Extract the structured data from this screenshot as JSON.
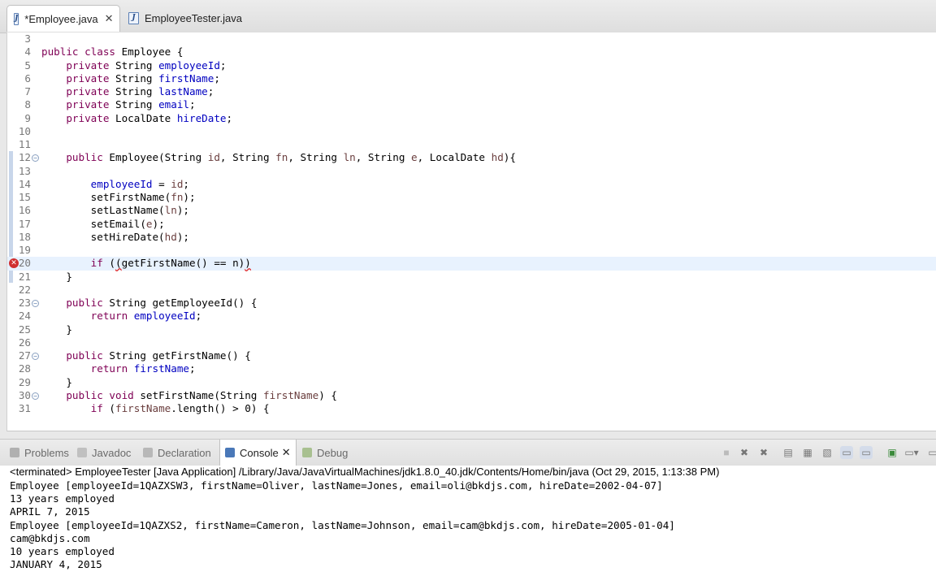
{
  "editor_tabs": [
    {
      "label": "*Employee.java",
      "close": "✕"
    },
    {
      "label": "EmployeeTester.java"
    }
  ],
  "code_lines": [
    {
      "num": "3",
      "html": ""
    },
    {
      "num": "4",
      "html": "<span class='kw'>public class</span> Employee {"
    },
    {
      "num": "5",
      "html": "    <span class='kw'>private</span> String <span class='fld'>employeeId</span>;"
    },
    {
      "num": "6",
      "html": "    <span class='kw'>private</span> String <span class='fld'>firstName</span>;"
    },
    {
      "num": "7",
      "html": "    <span class='kw'>private</span> String <span class='fld'>lastName</span>;"
    },
    {
      "num": "8",
      "html": "    <span class='kw'>private</span> String <span class='fld'>email</span>;"
    },
    {
      "num": "9",
      "html": "    <span class='kw'>private</span> LocalDate <span class='fld'>hireDate</span>;"
    },
    {
      "num": "10",
      "html": ""
    },
    {
      "num": "11",
      "html": ""
    },
    {
      "num": "12",
      "html": "    <span class='kw'>public</span> Employee(String <span class='par'>id</span>, String <span class='par'>fn</span>, String <span class='par'>ln</span>, String <span class='par'>e</span>, LocalDate <span class='par'>hd</span>){",
      "fold": true
    },
    {
      "num": "13",
      "html": ""
    },
    {
      "num": "14",
      "html": "        <span class='fld'>employeeId</span> = <span class='par'>id</span>;"
    },
    {
      "num": "15",
      "html": "        setFirstName(<span class='par'>fn</span>);"
    },
    {
      "num": "16",
      "html": "        setLastName(<span class='par'>ln</span>);"
    },
    {
      "num": "17",
      "html": "        setEmail(<span class='par'>e</span>);"
    },
    {
      "num": "18",
      "html": "        setHireDate(<span class='par'>hd</span>);"
    },
    {
      "num": "19",
      "html": ""
    },
    {
      "num": "20",
      "html": "        <span class='kw'>if</span> (<span class='squig'>(</span>getFirstName() == n)<span class='squig'>)</span>",
      "current": true,
      "error": true
    },
    {
      "num": "21",
      "html": "    }"
    },
    {
      "num": "22",
      "html": ""
    },
    {
      "num": "23",
      "html": "    <span class='kw'>public</span> String getEmployeeId() {",
      "fold": true
    },
    {
      "num": "24",
      "html": "        <span class='kw'>return</span> <span class='fld'>employeeId</span>;"
    },
    {
      "num": "25",
      "html": "    }"
    },
    {
      "num": "26",
      "html": ""
    },
    {
      "num": "27",
      "html": "    <span class='kw'>public</span> String getFirstName() {",
      "fold": true
    },
    {
      "num": "28",
      "html": "        <span class='kw'>return</span> <span class='fld'>firstName</span>;"
    },
    {
      "num": "29",
      "html": "    }"
    },
    {
      "num": "30",
      "html": "    <span class='kw'>public void</span> setFirstName(String <span class='par'>firstName</span>) {",
      "fold": true
    },
    {
      "num": "31",
      "html": "        <span class='kw'>if</span> (<span class='par'>firstName</span>.length() > 0) {"
    }
  ],
  "view_tabs": [
    {
      "label": "Problems",
      "icon": "problems-icon",
      "color": "#b0b0b0"
    },
    {
      "label": "Javadoc",
      "icon": "javadoc-icon",
      "color": "#c0c0c0"
    },
    {
      "label": "Declaration",
      "icon": "declaration-icon",
      "color": "#b8b8b8"
    },
    {
      "label": "Console",
      "icon": "console-icon",
      "color": "#4a78b8",
      "active": true
    },
    {
      "label": "Debug",
      "icon": "debug-icon",
      "color": "#a8c090"
    }
  ],
  "console": {
    "header": "<terminated> EmployeeTester [Java Application] /Library/Java/JavaVirtualMachines/jdk1.8.0_40.jdk/Contents/Home/bin/java (Oct 29, 2015, 1:13:38 PM)",
    "lines": [
      "Employee [employeeId=1QAZXSW3, firstName=Oliver, lastName=Jones, email=oli@bkdjs.com, hireDate=2002-04-07]",
      "13 years employed",
      "APRIL 7, 2015",
      "Employee [employeeId=1QAZXS2, firstName=Cameron, lastName=Johnson, email=cam@bkdjs.com, hireDate=2005-01-04]",
      "cam@bkdjs.com",
      "10 years employed",
      "JANUARY 4, 2015"
    ]
  },
  "colors": {
    "keyword": "#7f0055",
    "field": "#0000c0",
    "param": "#6a3e3e",
    "current_line": "#e8f2fe",
    "error": "#d03030"
  }
}
